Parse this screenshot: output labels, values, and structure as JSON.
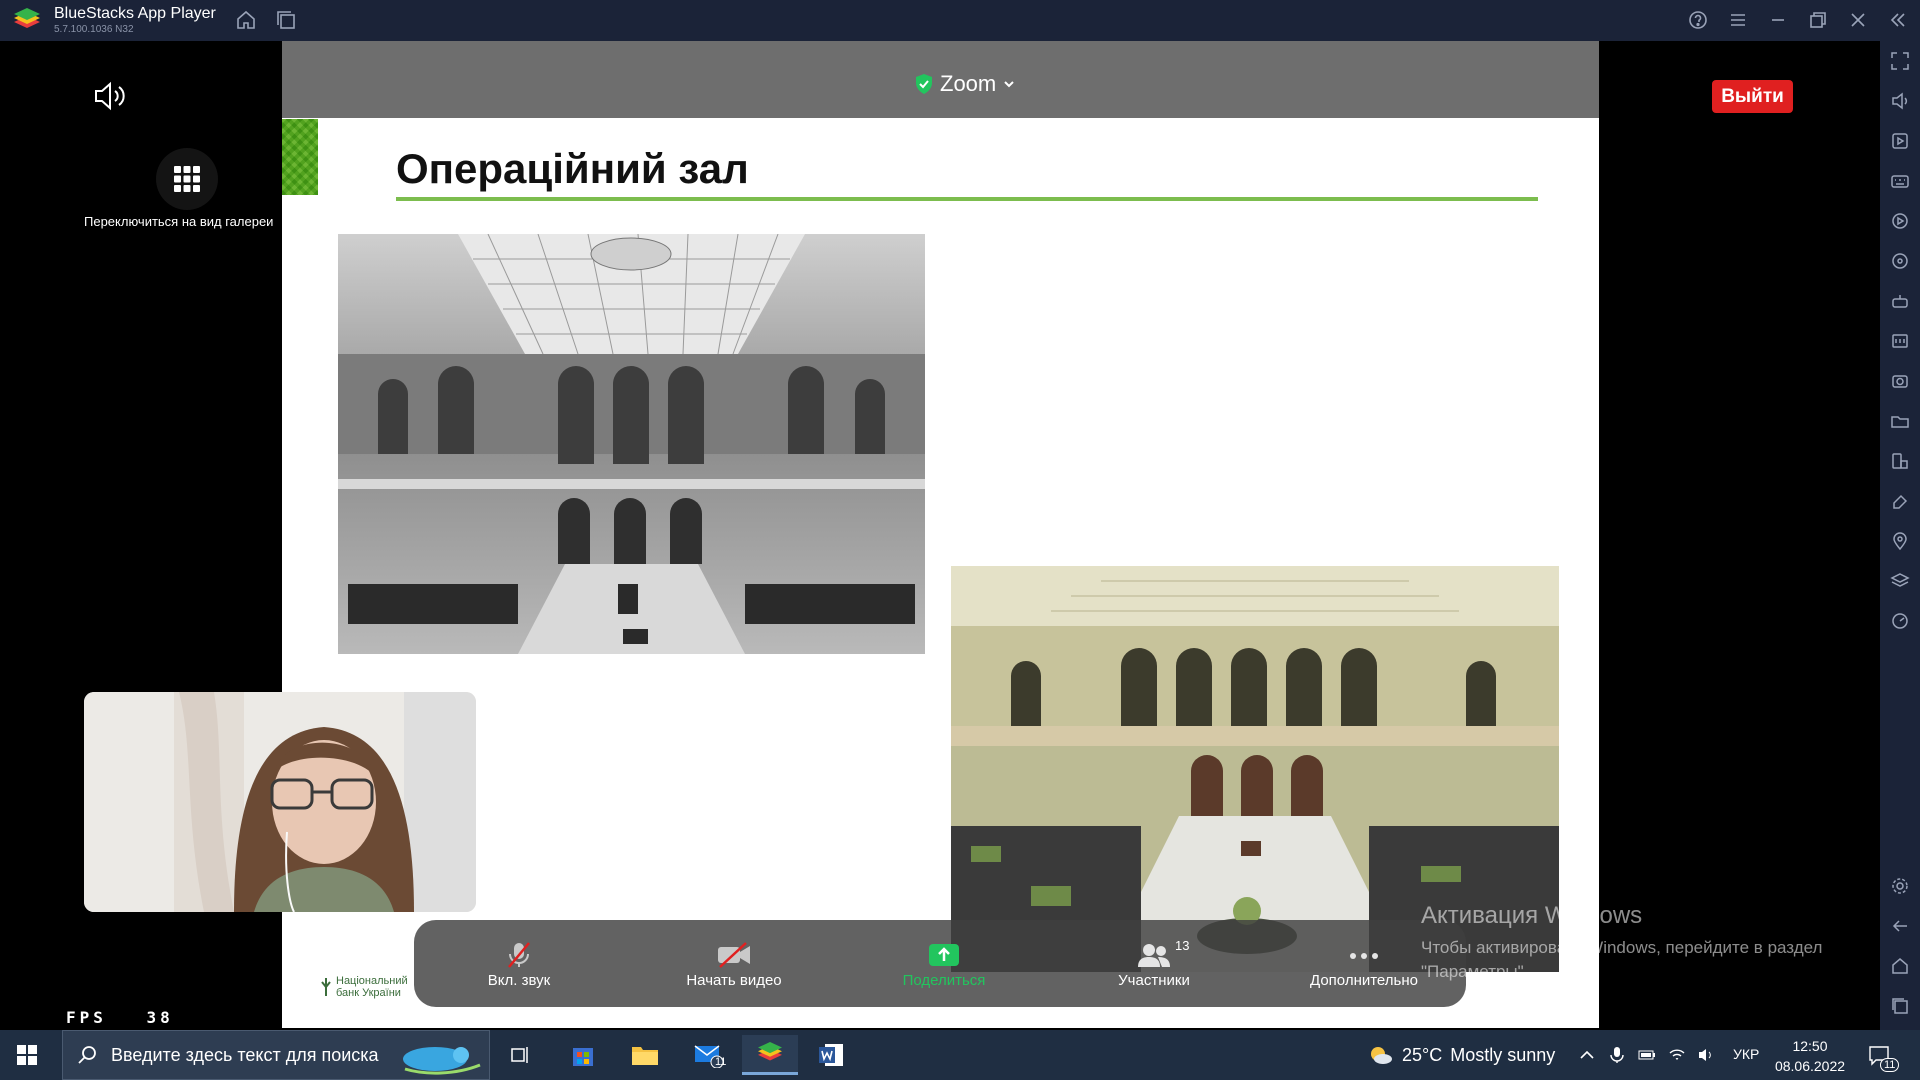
{
  "window": {
    "title": "BlueStacks App Player",
    "version": "5.7.100.1036  N32"
  },
  "zoom": {
    "header_label": "Zoom",
    "exit_label": "Выйти",
    "gallery_label": "Переключиться на вид галереи",
    "controls": [
      {
        "label": "Вкл. звук",
        "icon": "mic-muted-icon"
      },
      {
        "label": "Начать видео",
        "icon": "video-off-icon"
      },
      {
        "label": "Поделиться",
        "icon": "share-screen-icon"
      },
      {
        "label": "Участники",
        "icon": "participants-icon",
        "count": "13"
      },
      {
        "label": "Дополнительно",
        "icon": "more-icon"
      }
    ]
  },
  "slide": {
    "title": "Операційний зал",
    "logo_line1": "Національний",
    "logo_line2": "банк України"
  },
  "watermark": {
    "line1": "Активация Windows",
    "line2": "Чтобы активировать Windows, перейдите в раздел \"Параметры\"."
  },
  "fps": {
    "label": "FPS",
    "value": "38"
  },
  "taskbar": {
    "search_placeholder": "Введите здесь текст для поиска",
    "temperature": "25°C",
    "weather": "Mostly sunny",
    "language": "УКР",
    "time": "12:50",
    "date": "08.06.2022",
    "mail_badge": "11",
    "notification_badge": "11"
  },
  "colors": {
    "titlebar": "#1b2338",
    "exit_button": "#e02020",
    "slide_accent": "#7cbd4e",
    "share_green": "#22c55e"
  }
}
